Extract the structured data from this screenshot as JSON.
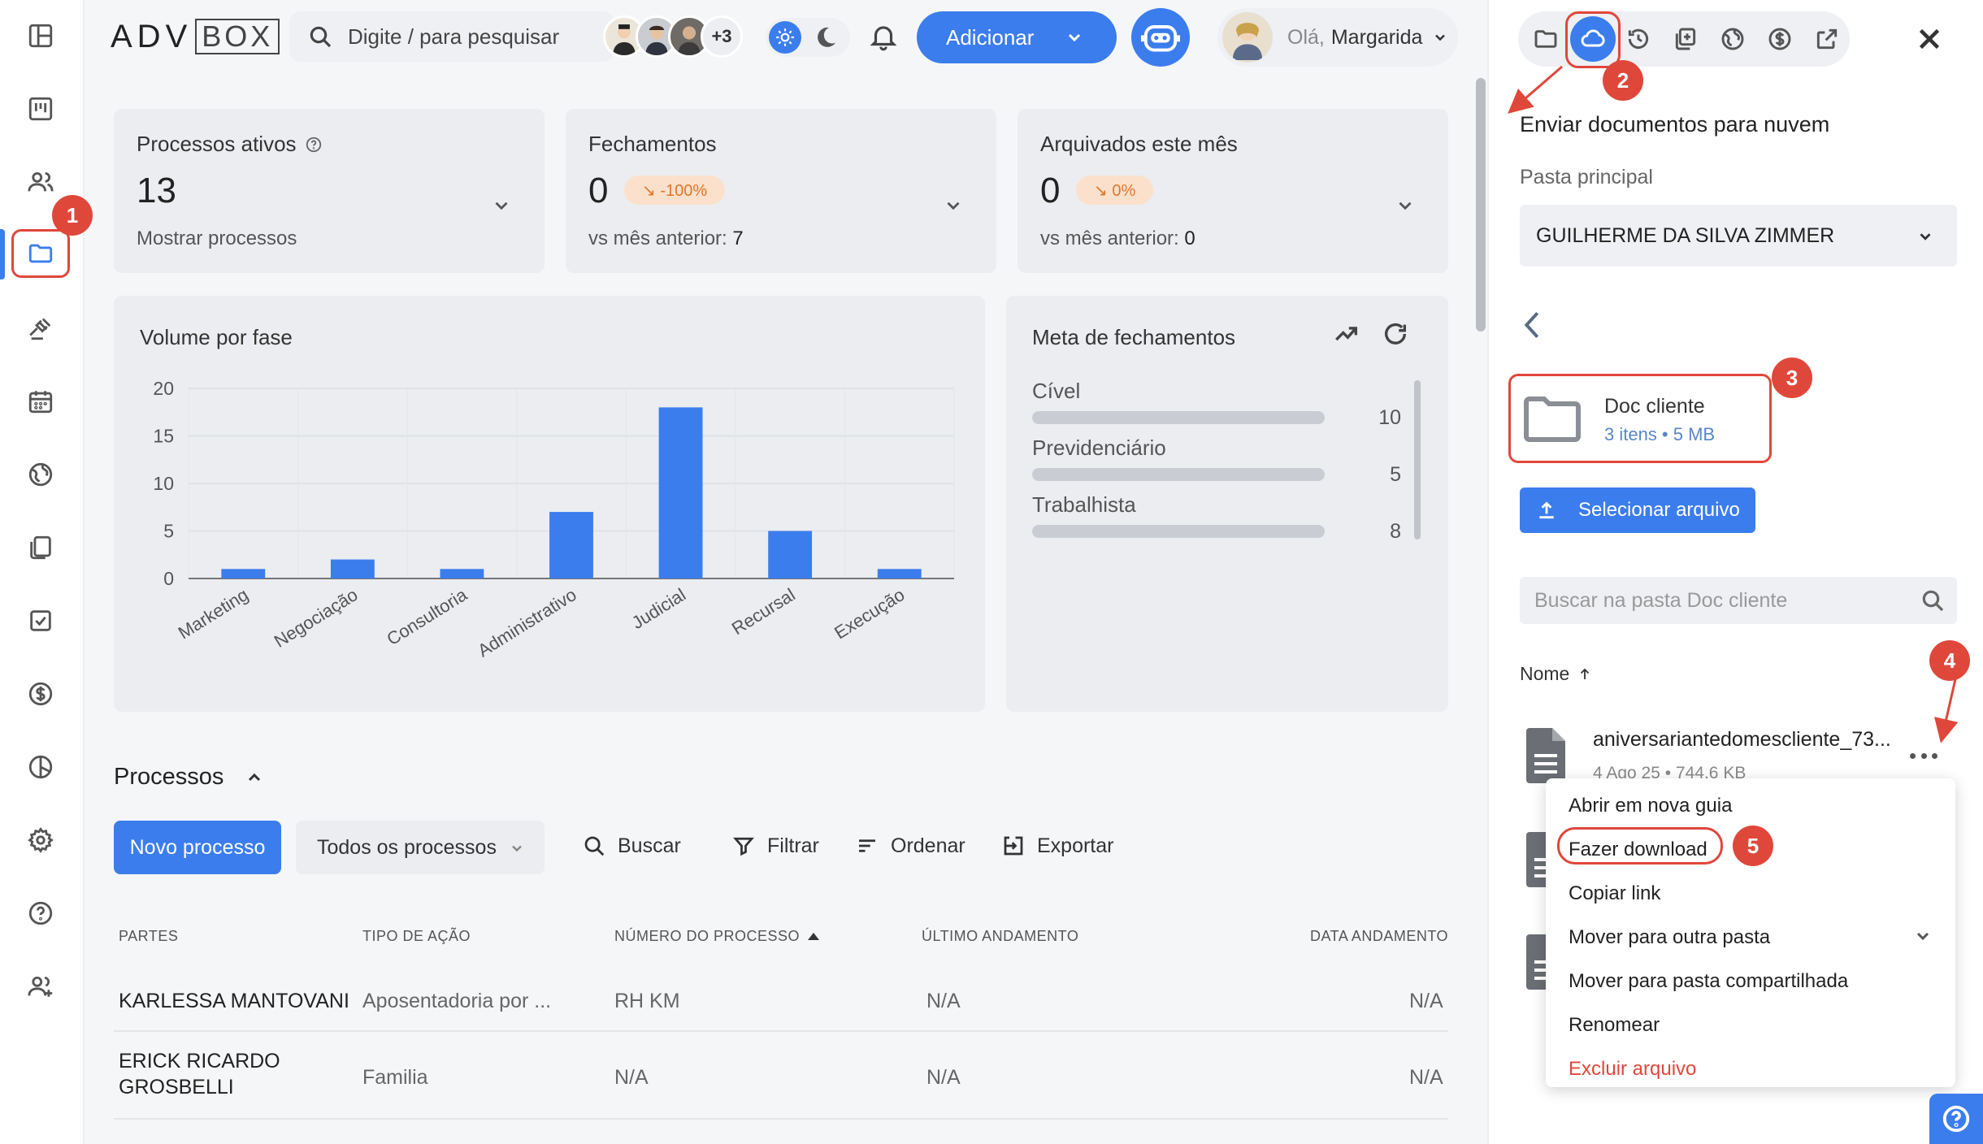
{
  "header": {
    "logo_adv": "ADV",
    "logo_box": "BOX",
    "search_placeholder": "Digite / para pesquisar",
    "more_users": "+3",
    "add_label": "Adicionar",
    "greeting": "Olá,",
    "user_name": "Margarida"
  },
  "stats": [
    {
      "title": "Processos ativos",
      "value": "13",
      "sub": "Mostrar processos"
    },
    {
      "title": "Fechamentos",
      "value": "0",
      "badge": "↘ -100%",
      "sub_prefix": "vs mês anterior:",
      "sub_value": "7"
    },
    {
      "title": "Arquivados este mês",
      "value": "0",
      "badge": "↘ 0%",
      "sub_prefix": "vs mês anterior:",
      "sub_value": "0"
    }
  ],
  "chart_data": {
    "type": "bar",
    "title": "Volume por fase",
    "categories": [
      "Marketing",
      "Negociação",
      "Consultoria",
      "Administrativo",
      "Judicial",
      "Recursal",
      "Execução"
    ],
    "values": [
      1,
      2,
      1,
      7,
      18,
      5,
      1
    ],
    "ylim": [
      0,
      20
    ],
    "yticks": [
      0,
      5,
      10,
      15,
      20
    ],
    "grid": true,
    "color": "#3b7ded"
  },
  "goals": {
    "title": "Meta de fechamentos",
    "items": [
      {
        "label": "Cível",
        "value": "10"
      },
      {
        "label": "Previdenciário",
        "value": "5"
      },
      {
        "label": "Trabalhista",
        "value": "8"
      }
    ]
  },
  "processes": {
    "title": "Processos",
    "new_label": "Novo processo",
    "filter_select": "Todos os processos",
    "search_label": "Buscar",
    "filter_label": "Filtrar",
    "sort_label": "Ordenar",
    "export_label": "Exportar",
    "columns": [
      "PARTES",
      "TIPO DE AÇÃO",
      "NÚMERO DO PROCESSO",
      "ÚLTIMO ANDAMENTO",
      "DATA ANDAMENTO"
    ],
    "rows": [
      {
        "partes": "KARLESSA MANTOVANI",
        "tipo": "Aposentadoria por ...",
        "numero": "RH KM",
        "andamento": "N/A",
        "data": "N/A"
      },
      {
        "partes_l1": "ERICK RICARDO",
        "partes_l2": "GROSBELLI",
        "tipo": "Familia",
        "numero": "N/A",
        "andamento": "N/A",
        "data": "N/A"
      }
    ]
  },
  "cloud_panel": {
    "title": "Enviar documentos para nuvem",
    "folder_label": "Pasta principal",
    "folder_selected": "GUILHERME DA SILVA ZIMMER",
    "subfolder_name": "Doc cliente",
    "subfolder_meta": "3 itens • 5 MB",
    "upload_label": "Selecionar arquivo",
    "search_placeholder": "Buscar na pasta Doc cliente",
    "column_name": "Nome",
    "file_name": "aniversariantedomescliente_73...",
    "file_meta": "4 Ago 25 • 744,6 KB"
  },
  "context_menu": {
    "open_new_tab": "Abrir em nova guia",
    "download": "Fazer download",
    "copy_link": "Copiar link",
    "move_folder": "Mover para outra pasta",
    "move_shared": "Mover para pasta compartilhada",
    "rename": "Renomear",
    "delete": "Excluir arquivo"
  },
  "annotations": [
    "1",
    "2",
    "3",
    "4",
    "5"
  ],
  "colors": {
    "accent": "#3b7ded",
    "annotation": "#e0473b",
    "badge_bg": "#fbe1cc",
    "badge_text": "#e0762c"
  }
}
